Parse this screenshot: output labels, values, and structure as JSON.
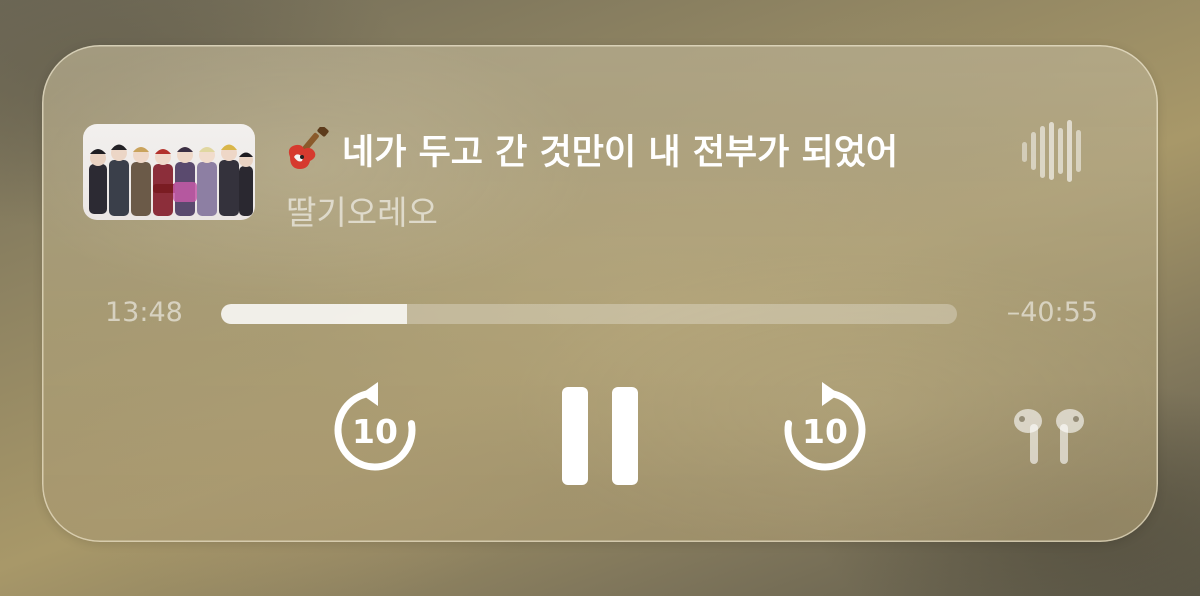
{
  "now_playing": {
    "title_emoji": "🎸",
    "title": "네가 두고 간 것만이 내 전부가 되었어",
    "artist": "딸기오레오",
    "artwork_icon": "album-artwork",
    "waveform_icon": "audio-waveform-icon"
  },
  "progress": {
    "elapsed": "13:48",
    "remaining": "–40:55",
    "fraction": 0.253
  },
  "controls": {
    "skip_back_label": "10",
    "skip_forward_label": "10",
    "skip_back_icon": "skip-back-10-icon",
    "play_pause_icon": "pause-icon",
    "skip_forward_icon": "skip-forward-10-icon",
    "output_icon": "airpods-icon"
  },
  "colors": {
    "primary_text": "#ffffff",
    "secondary_text": "rgba(255,255,255,0.58)",
    "progress_fill": "rgba(255,255,255,0.78)",
    "progress_track": "rgba(255,255,255,0.28)"
  }
}
